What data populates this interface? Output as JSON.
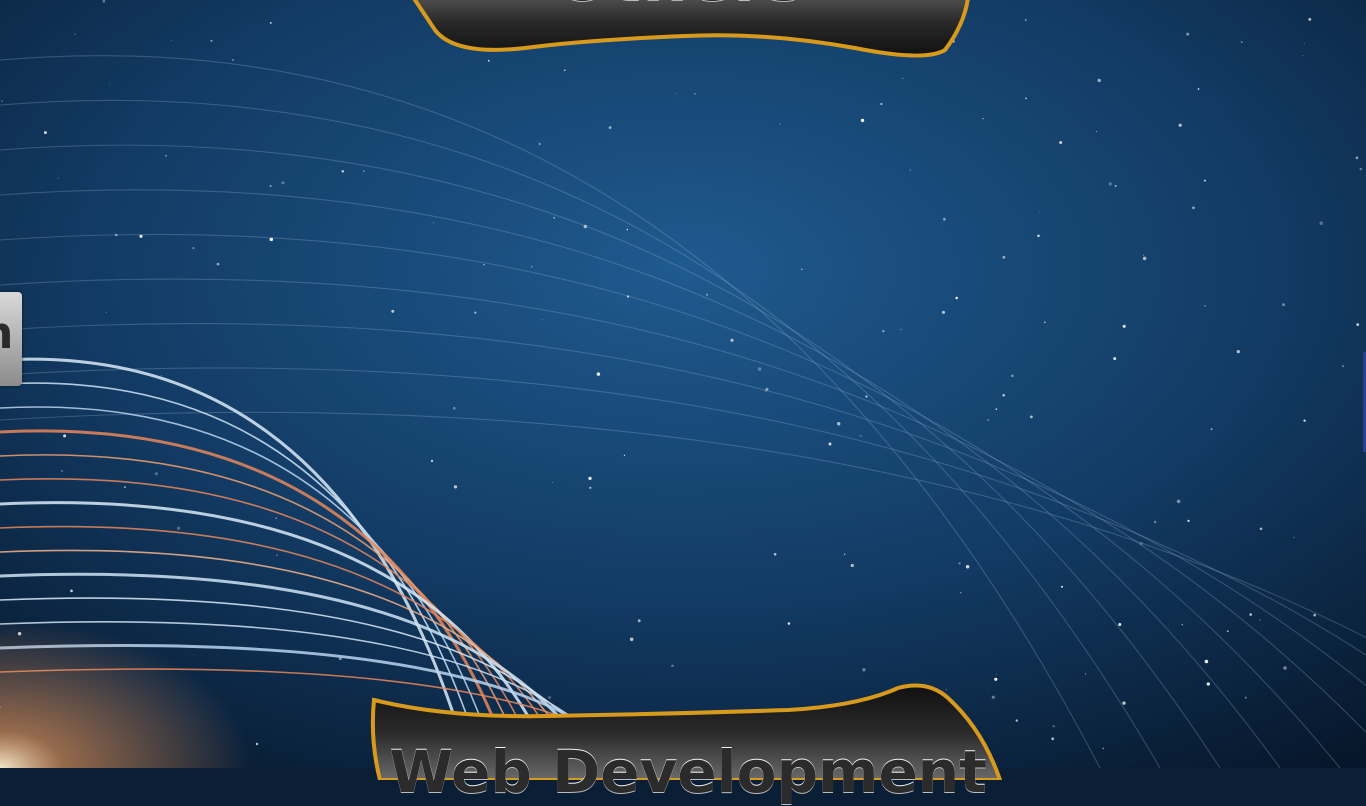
{
  "slide": {
    "top_banner": {
      "label": "Others"
    },
    "bottom_banner": {
      "label": "Web Development"
    },
    "side_tab": {
      "label": "n"
    }
  },
  "colors": {
    "space_deep": "#081a30",
    "space_blue": "#1c4f80",
    "banner_dark": "#1b1b1b",
    "banner_gold": "#d89a1c",
    "ring_white": "#cfe3f5",
    "ring_orange": "#e8875a"
  }
}
